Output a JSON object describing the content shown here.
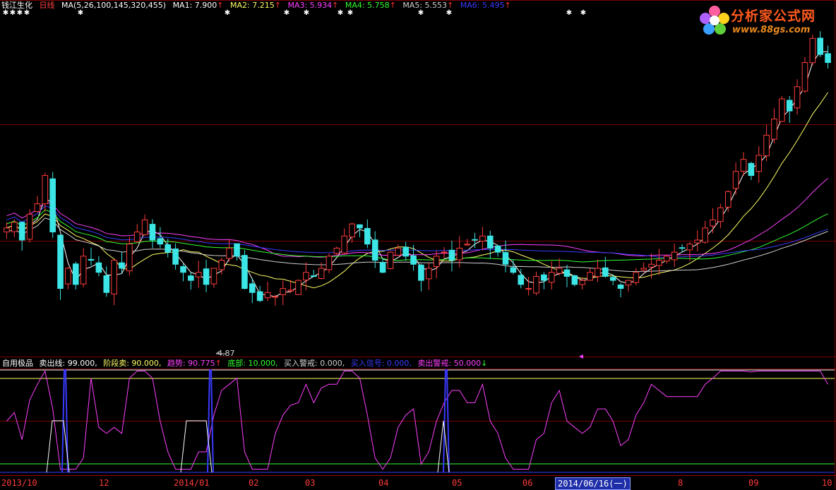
{
  "window": {
    "stock_name": "钱江生化",
    "period": "日线",
    "ma_params": "MA(5,26,100,145,320,455)"
  },
  "ma_legend": [
    {
      "label": "MA1: 7.900",
      "arrow": "↑",
      "color": "#ffffff"
    },
    {
      "label": "MA2: 7.215",
      "arrow": "↑",
      "color": "#ffff66"
    },
    {
      "label": "MA3: 5.934",
      "arrow": "↑",
      "color": "#ff40ff"
    },
    {
      "label": "MA4: 5.758",
      "arrow": "↑",
      "color": "#33ff33"
    },
    {
      "label": "MA5: 5.553",
      "arrow": "↑",
      "color": "#d0d0d0"
    },
    {
      "label": "MA6: 5.495",
      "arrow": "↑",
      "color": "#3a3aff"
    }
  ],
  "indicator": {
    "name": "自用极品",
    "items": [
      {
        "label": "卖出线: 99.000,",
        "color": "#ffffff"
      },
      {
        "label": "阶段卖: 90.000,",
        "color": "#ffff66"
      },
      {
        "label": "趋势: 90.775",
        "arrow": "↑",
        "color": "#ff40ff"
      },
      {
        "label": "底部: 10.000,",
        "color": "#33ff33"
      },
      {
        "label": "买入警戒: 0.000,",
        "color": "#d0d0d0"
      },
      {
        "label": "买入信号: 0.000,",
        "color": "#3a3aff"
      },
      {
        "label": "卖出警戒: 50.000",
        "arrow": "↓",
        "color": "#ff40ff"
      }
    ]
  },
  "low_marker": "4.87",
  "x_axis": {
    "ticks": [
      "2013/10",
      "12",
      "2014/01",
      "02",
      "03",
      "04",
      "05",
      "06",
      "8",
      "09",
      "10"
    ],
    "cursor_date": "2014/06/16(一)"
  },
  "logo": {
    "name": "分析家公式网",
    "url": "www.88gs.com"
  },
  "chart_data": {
    "type": "candlestick",
    "y_range": [
      4.2,
      8.4
    ],
    "close": [
      5.75,
      5.82,
      5.6,
      5.92,
      6.05,
      6.4,
      5.7,
      5.0,
      5.25,
      5.05,
      5.4,
      5.35,
      5.2,
      4.95,
      5.35,
      5.25,
      5.55,
      5.7,
      5.85,
      5.6,
      5.55,
      5.45,
      5.3,
      5.2,
      5.1,
      5.2,
      5.05,
      5.25,
      5.35,
      5.5,
      5.4,
      5.0,
      4.95,
      4.85,
      4.95,
      4.9,
      5.0,
      4.98,
      5.1,
      5.2,
      5.15,
      5.25,
      5.4,
      5.5,
      5.65,
      5.8,
      5.75,
      5.55,
      5.35,
      5.2,
      5.45,
      5.5,
      5.4,
      5.3,
      5.1,
      5.25,
      5.4,
      5.45,
      5.35,
      5.5,
      5.55,
      5.6,
      5.65,
      5.5,
      5.45,
      5.3,
      5.2,
      5.05,
      5.0,
      5.15,
      5.1,
      5.2,
      5.25,
      5.15,
      5.05,
      5.1,
      5.2,
      5.25,
      5.15,
      5.1,
      5.0,
      5.1,
      5.2,
      5.25,
      5.3,
      5.35,
      5.4,
      5.45,
      5.5,
      5.55,
      5.6,
      5.75,
      5.85,
      6.0,
      6.2,
      6.45,
      6.6,
      6.4,
      6.65,
      6.9,
      7.1,
      7.35,
      7.2,
      7.5,
      7.8,
      8.1,
      7.9,
      7.8
    ]
  }
}
